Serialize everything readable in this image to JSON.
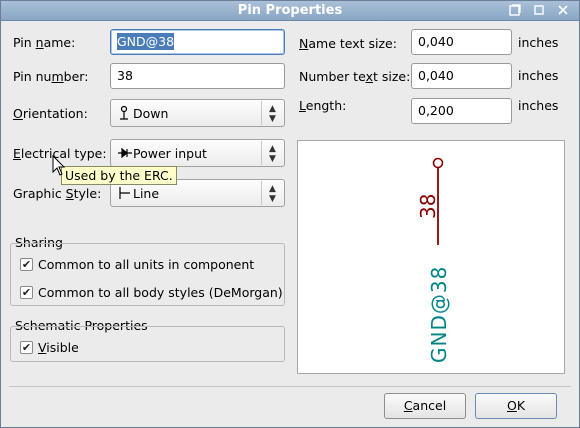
{
  "window": {
    "title": "Pin Properties",
    "controls": [
      "restore-icon",
      "minimize-icon",
      "close-icon"
    ]
  },
  "left": {
    "pin_name": {
      "label_pre": "Pin ",
      "label_u": "n",
      "label_post": "ame:",
      "value": "GND@38"
    },
    "pin_number": {
      "label_pre": "Pin nu",
      "label_u": "m",
      "label_post": "ber:",
      "value": "38"
    },
    "orientation": {
      "label_pre": "",
      "label_u": "O",
      "label_post": "rientation:",
      "value": "Down",
      "icon": "pin-down-icon"
    },
    "electrical_type": {
      "label_pre": "",
      "label_u": "E",
      "label_post": "lectrical type:",
      "value": "Power input",
      "icon": "power-input-icon"
    },
    "graphic_style": {
      "label_pre": "Graphic ",
      "label_u": "S",
      "label_post": "tyle:",
      "value": "Line",
      "icon": "line-style-icon"
    }
  },
  "tooltip": "Used by the ERC.",
  "sharing": {
    "title": "Sharing",
    "units": "Common to all units in component",
    "body_styles": "Common to all body styles (DeMorgan)"
  },
  "schematic": {
    "title": "Schematic Properties",
    "visible_u": "V",
    "visible_rest": "isible"
  },
  "right": {
    "name_text_size": {
      "label_pre": "",
      "label_u": "N",
      "label_post": "ame text size:",
      "value": "0,040",
      "unit": "inches"
    },
    "number_text_size": {
      "label_pre": "Number te",
      "label_u": "x",
      "label_post": "t size:",
      "value": "0,040",
      "unit": "inches"
    },
    "length": {
      "label_pre": "",
      "label_u": "L",
      "label_post": "ength:",
      "value": "0,200",
      "unit": "inches"
    }
  },
  "preview": {
    "pin_number": "38",
    "pin_name": "GND@38",
    "number_color": "#8b0000",
    "name_color": "#008484",
    "pin_color": "#8b0000"
  },
  "buttons": {
    "cancel_u": "C",
    "cancel_rest": "ancel",
    "ok_u": "O",
    "ok_rest": "K"
  }
}
